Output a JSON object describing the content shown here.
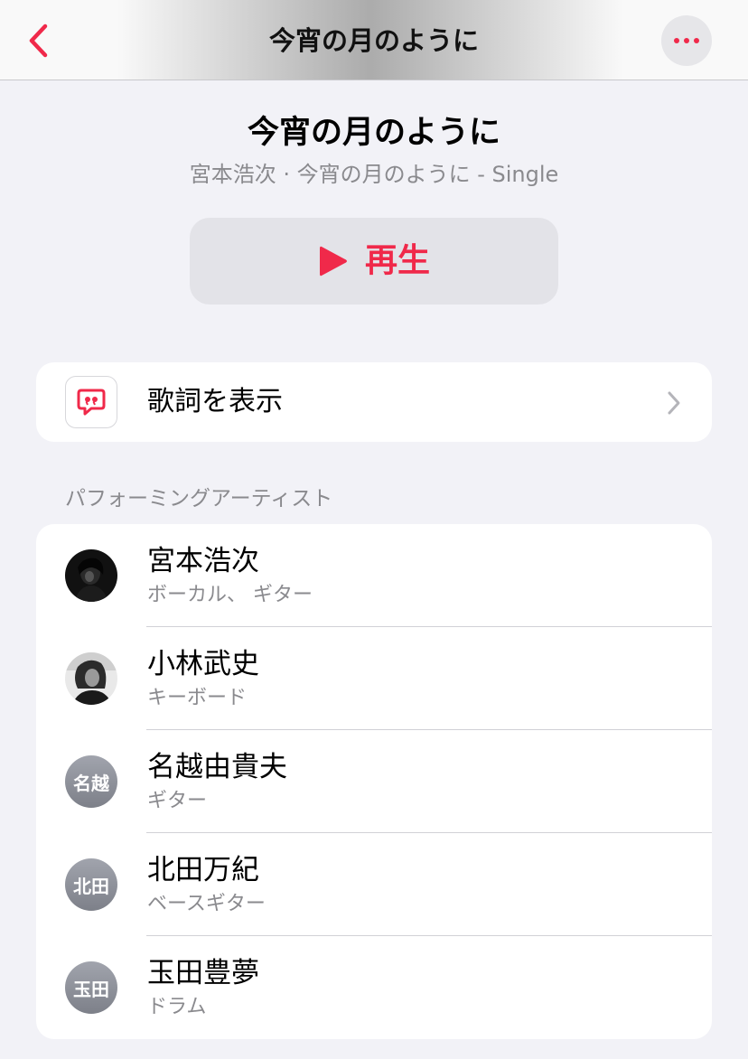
{
  "nav": {
    "title": "今宵の月のように",
    "back_icon": "chevron-left-icon",
    "more_icon": "ellipsis-icon"
  },
  "header": {
    "title": "今宵の月のように",
    "subtitle": "宮本浩次 · 今宵の月のように - Single"
  },
  "play_button": {
    "label": "再生",
    "icon": "play-icon"
  },
  "lyrics": {
    "label": "歌詞を表示",
    "icon": "quote-bubble-icon"
  },
  "artists_section": {
    "header": "パフォーミングアーティスト",
    "items": [
      {
        "name": "宮本浩次",
        "role": "ボーカル、 ギター",
        "initials": ""
      },
      {
        "name": "小林武史",
        "role": "キーボード",
        "initials": ""
      },
      {
        "name": "名越由貴夫",
        "role": "ギター",
        "initials": "名越"
      },
      {
        "name": "北田万紀",
        "role": "ベースギター",
        "initials": "北田"
      },
      {
        "name": "玉田豊夢",
        "role": "ドラム",
        "initials": "玉田"
      }
    ]
  },
  "colors": {
    "accent": "#f0294a",
    "background": "#f2f2f7",
    "secondary_text": "#8a8a8e"
  }
}
